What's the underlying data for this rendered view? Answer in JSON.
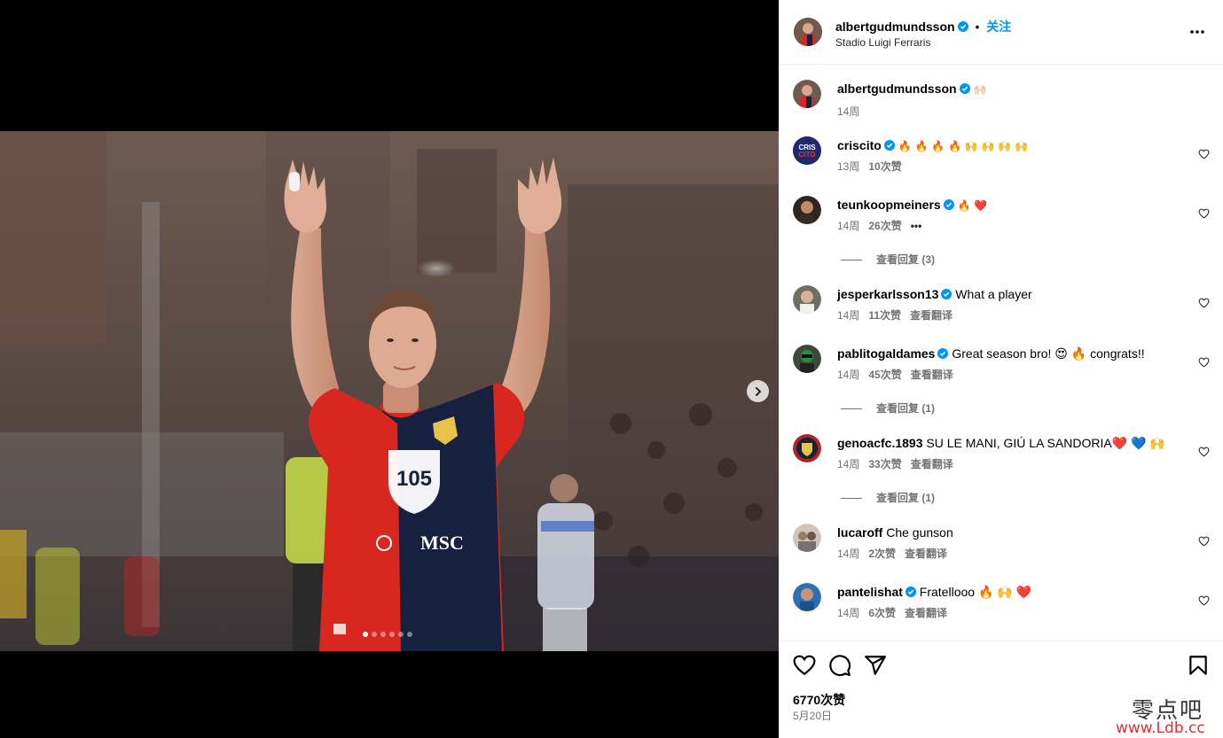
{
  "post": {
    "username": "albertgudmundsson",
    "separator": "•",
    "follow_label": "关注",
    "location": "Stadio Luigi Ferraris",
    "likes": "6770次赞",
    "date": "5月20日"
  },
  "caption": {
    "username": "albertgudmundsson",
    "text": "🙌🏻",
    "time": "14周"
  },
  "comments": [
    {
      "username": "criscito",
      "text": "🔥 🔥 🔥 🔥 🙌 🙌 🙌 🙌",
      "time": "13周",
      "likes": "10次赞",
      "avatar_color": "#1f2a6b"
    },
    {
      "username": "teunkoopmeiners",
      "text": "🔥 ❤️",
      "time": "14周",
      "likes": "26次赞",
      "more": "•••",
      "replies": "查看回复 (3)",
      "avatar_color": "#6b4a2f"
    },
    {
      "username": "jesperkarlsson13",
      "text": "What a player",
      "time": "14周",
      "likes": "11次赞",
      "translate": "查看翻译",
      "avatar_color": "#8a8a7a"
    },
    {
      "username": "pablitogaldames",
      "text": "Great season bro! 😍 🔥  congrats!!",
      "time": "14周",
      "likes": "45次赞",
      "translate": "查看翻译",
      "replies": "查看回复 (1)",
      "avatar_color": "#3a5a3a"
    },
    {
      "username": "genoacfc.1893",
      "text": "SU LE MANI, GIÚ LA SANDORIA❤️ 💙 🙌",
      "time": "14周",
      "likes": "33次赞",
      "translate": "查看翻译",
      "replies": "查看回复 (1)",
      "avatar_color": "#b22222"
    },
    {
      "username": "lucaroff",
      "text": "Che gunson",
      "time": "14周",
      "likes": "2次赞",
      "translate": "查看翻译",
      "avatar_color": "#9a8f80"
    },
    {
      "username": "pantelishat",
      "text": "Fratellooo 🔥 🙌 ❤️",
      "time": "14周",
      "likes": "6次赞",
      "translate": "查看翻译",
      "avatar_color": "#2c6fb5"
    }
  ],
  "photo": {
    "jersey_sponsor": "MSC",
    "jersey_number_logo": "105"
  },
  "carousel": {
    "count": 6,
    "active": 1
  },
  "colors": {
    "accent": "#0095f6",
    "verified": "#0095f6",
    "jersey_red": "#d8271f",
    "jersey_navy": "#16203f"
  },
  "icons": [
    "heart-icon",
    "comment-icon",
    "share-icon",
    "bookmark-icon",
    "more-icon",
    "verified-icon",
    "chevron-right-icon"
  ],
  "watermark": {
    "top": "零点吧",
    "bottom": "www.Ldb.cc"
  }
}
